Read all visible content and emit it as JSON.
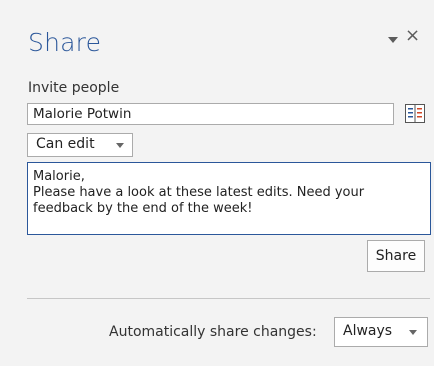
{
  "pane": {
    "title": "Share",
    "menu_icon": "chevron-down-icon",
    "close_glyph": "×",
    "accent_color": "#2b579a"
  },
  "invite": {
    "label": "Invite people",
    "value": "Malorie Potwin",
    "address_book_icon": "address-book-icon"
  },
  "permission": {
    "selected": "Can edit"
  },
  "message": {
    "lines": [
      "Malorie,",
      "Please have a look at these latest edits. Need your",
      "feedback by the end of the week!"
    ]
  },
  "share_button": {
    "label": "Share"
  },
  "auto_share": {
    "label": "Automatically share changes:",
    "selected": "Always"
  }
}
